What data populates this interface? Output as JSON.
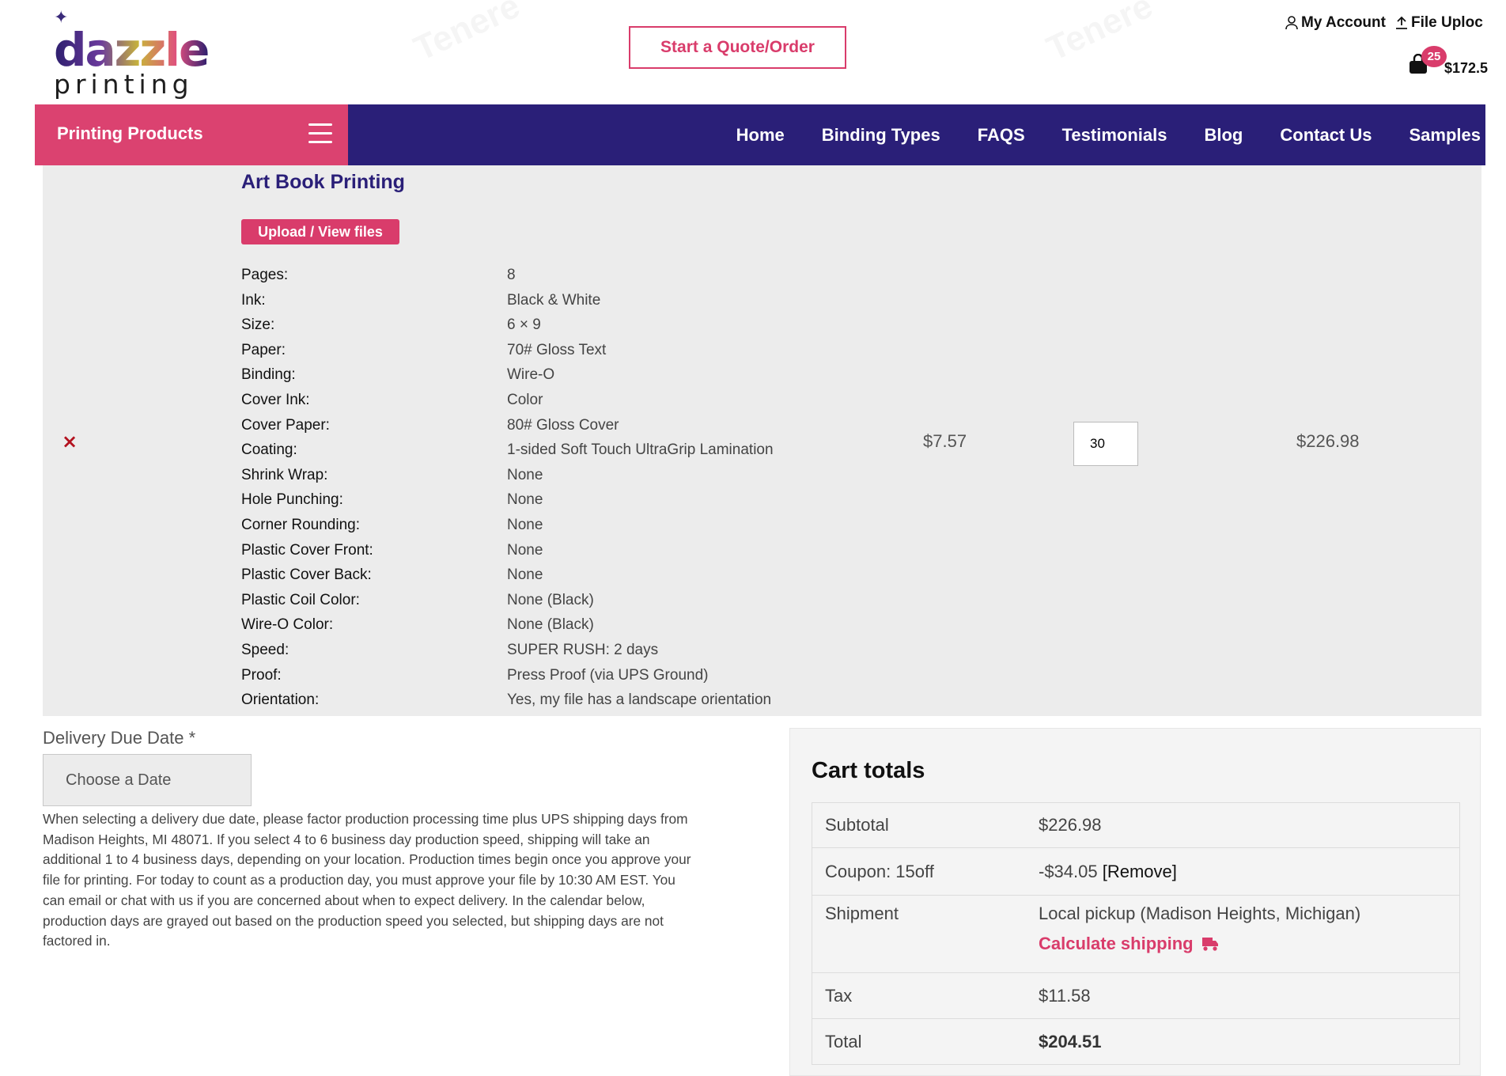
{
  "header": {
    "logo_line1": "dazzle",
    "logo_line2": "printing",
    "quote_button": "Start a Quote/Order",
    "my_account": "My Account",
    "file_upload": "File Uploc",
    "cart_count": "25",
    "cart_amount": "$172.5"
  },
  "nav": {
    "products_label": "Printing Products",
    "items": [
      "Home",
      "Binding Types",
      "FAQS",
      "Testimonials",
      "Blog",
      "Contact Us",
      "Samples"
    ]
  },
  "cart_item": {
    "remove_symbol": "×",
    "title": "Art Book Printing",
    "upload_button": "Upload / View files",
    "specs": [
      {
        "k": "Pages:",
        "v": "8"
      },
      {
        "k": "Ink:",
        "v": "Black & White"
      },
      {
        "k": "Size:",
        "v": "6 × 9"
      },
      {
        "k": "Paper:",
        "v": "70# Gloss Text"
      },
      {
        "k": "Binding:",
        "v": "Wire-O"
      },
      {
        "k": "Cover Ink:",
        "v": "Color"
      },
      {
        "k": "Cover Paper:",
        "v": "80# Gloss Cover"
      },
      {
        "k": "Coating:",
        "v": "1-sided Soft Touch UltraGrip Lamination"
      },
      {
        "k": "Shrink Wrap:",
        "v": "None"
      },
      {
        "k": "Hole Punching:",
        "v": "None"
      },
      {
        "k": "Corner Rounding:",
        "v": "None"
      },
      {
        "k": "Plastic Cover Front:",
        "v": "None"
      },
      {
        "k": "Plastic Cover Back:",
        "v": "None"
      },
      {
        "k": "Plastic Coil Color:",
        "v": "None (Black)"
      },
      {
        "k": "Wire-O Color:",
        "v": "None (Black)"
      },
      {
        "k": "Speed:",
        "v": "SUPER RUSH: 2 days"
      },
      {
        "k": "Proof:",
        "v": "Press Proof (via UPS Ground)"
      },
      {
        "k": "Orientation:",
        "v": "Yes, my file has a landscape orientation"
      }
    ],
    "unit_price": "$7.57",
    "quantity": "30",
    "line_total": "$226.98"
  },
  "delivery": {
    "label": "Delivery Due Date *",
    "placeholder": "Choose a Date",
    "help_text": "When selecting a delivery due date, please factor production processing time plus UPS shipping days from Madison Heights, MI 48071. If you select 4 to 6 business day production speed, shipping will take an additional 1 to 4 business days, depending on your location. Production times begin once you approve your file for printing. For today to count as a production day, you must approve your file by 10:30 AM EST. You can email or chat with us if you are concerned about when to expect delivery. In the calendar below, production days are grayed out based on the production speed you selected, but shipping days are not factored in."
  },
  "totals": {
    "title": "Cart totals",
    "subtotal_label": "Subtotal",
    "subtotal_value": "$226.98",
    "coupon_label": "Coupon: 15off",
    "coupon_value": "-$34.05",
    "coupon_remove": "[Remove]",
    "shipment_label": "Shipment",
    "shipment_value": "Local pickup (Madison Heights, Michigan)",
    "calc_shipping": "Calculate shipping",
    "tax_label": "Tax",
    "tax_value": "$11.58",
    "total_label": "Total",
    "total_value": "$204.51"
  },
  "colors": {
    "brand_pink": "#d93c6b",
    "nav_indigo": "#2a1f78",
    "panel_gray": "#ececec"
  }
}
